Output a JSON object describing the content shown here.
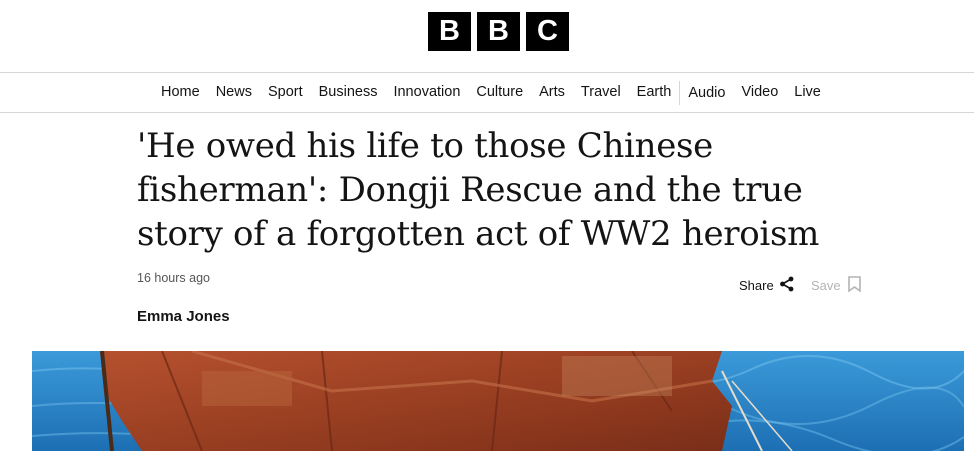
{
  "logo": {
    "letters": [
      "B",
      "B",
      "C"
    ]
  },
  "nav": {
    "items": [
      "Home",
      "News",
      "Sport",
      "Business",
      "Innovation",
      "Culture",
      "Arts",
      "Travel",
      "Earth",
      "Audio",
      "Video",
      "Live"
    ]
  },
  "article": {
    "headline": "'He owed his life to those Chinese fisherman': Dongji Rescue and the true story of a forgotten act of WW2 heroism",
    "timestamp": "16 hours ago",
    "byline": "Emma Jones"
  },
  "actions": {
    "share_label": "Share",
    "save_label": "Save"
  },
  "icons": {
    "share": "share-icon",
    "save": "bookmark-icon"
  },
  "colors": {
    "logo_bg": "#000000",
    "text": "#141414",
    "muted": "#545658",
    "disabled": "#b4b4b4",
    "divider": "#d6d6d6"
  }
}
